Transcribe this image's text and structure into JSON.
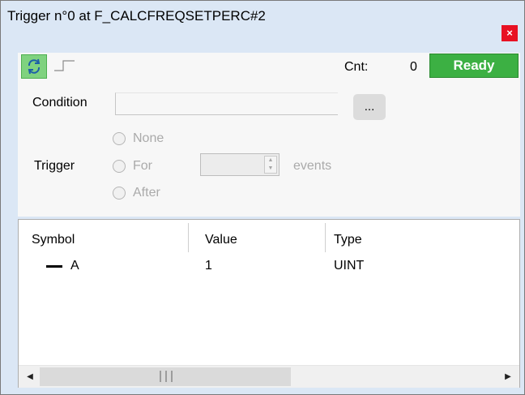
{
  "window": {
    "title": "Trigger n°0 at F_CALCFREQSETPERC#2",
    "close_glyph": "×"
  },
  "toolbar": {
    "refresh_icon": "refresh-icon",
    "edge_icon": "rising-edge-icon",
    "cnt_label": "Cnt:",
    "cnt_value": "0",
    "status": "Ready"
  },
  "condition": {
    "label": "Condition",
    "value": "",
    "browse_label": "..."
  },
  "trigger": {
    "label": "Trigger",
    "options": [
      "None",
      "For",
      "After"
    ],
    "count_value": "",
    "events_label": "events"
  },
  "table": {
    "columns": [
      "Symbol",
      "Value",
      "Type"
    ],
    "rows": [
      {
        "symbol": "A",
        "value": "1",
        "type": "UINT"
      }
    ]
  },
  "colors": {
    "ready": "#3cb043",
    "close": "#e81123",
    "window_bg": "#dbe7f5",
    "refresh_bg": "#7fd27f"
  }
}
